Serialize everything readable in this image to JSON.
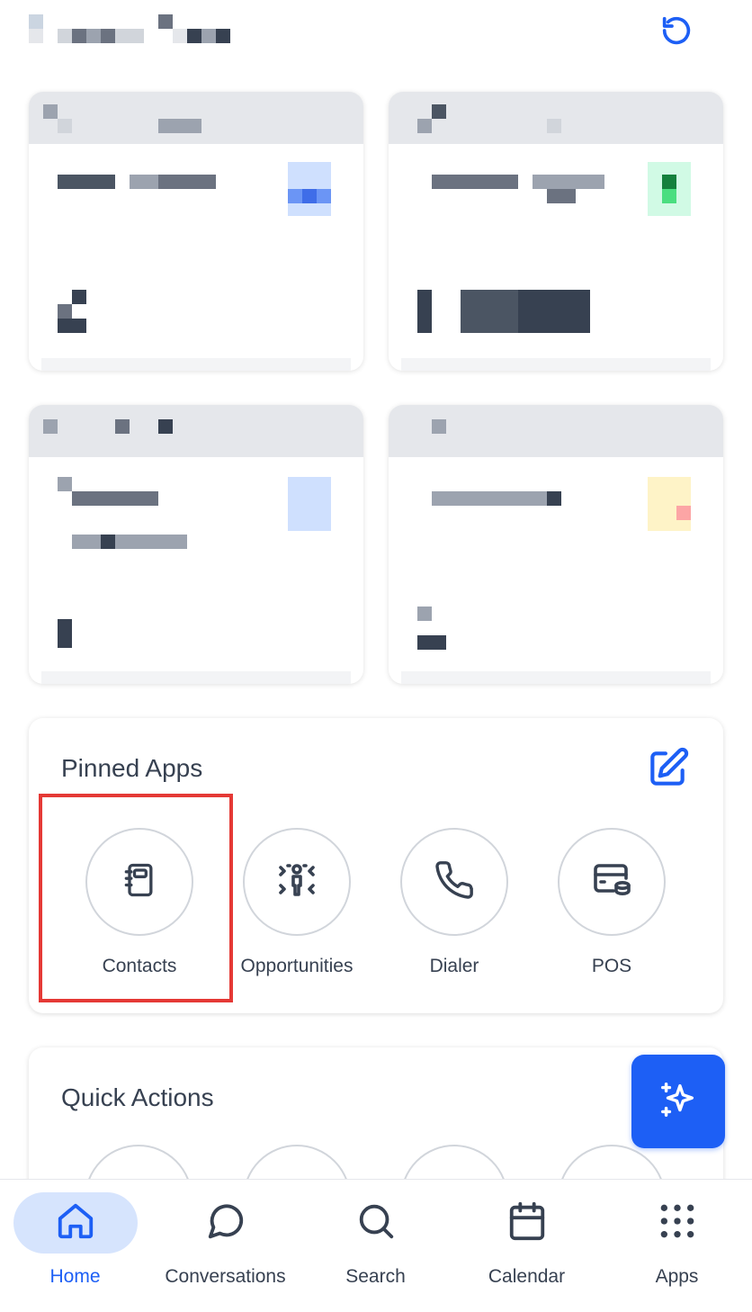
{
  "pinned_apps": {
    "title": "Pinned Apps",
    "items": [
      {
        "label": "Contacts",
        "icon": "contacts-book-icon"
      },
      {
        "label": "Opportunities",
        "icon": "opportunities-icon"
      },
      {
        "label": "Dialer",
        "icon": "phone-icon"
      },
      {
        "label": "POS",
        "icon": "pos-card-icon"
      }
    ]
  },
  "quick_actions": {
    "title": "Quick Actions"
  },
  "bottom_nav": {
    "items": [
      {
        "label": "Home",
        "icon": "home-icon",
        "active": true
      },
      {
        "label": "Conversations",
        "icon": "chat-bubble-icon",
        "active": false
      },
      {
        "label": "Search",
        "icon": "search-icon",
        "active": false
      },
      {
        "label": "Calendar",
        "icon": "calendar-icon",
        "active": false
      },
      {
        "label": "Apps",
        "icon": "apps-grid-icon",
        "active": false
      }
    ]
  },
  "colors": {
    "accent": "#1d5ff5",
    "active_nav_bg": "#d6e4fd",
    "highlight_border": "#e53935",
    "text": "#374151"
  }
}
